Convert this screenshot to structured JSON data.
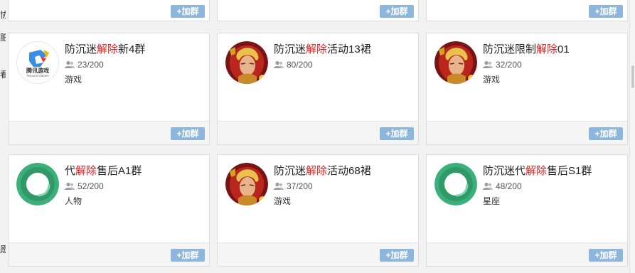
{
  "join_label": "+加群",
  "left_glimpse": [
    "协",
    "肥",
    "看",
    "愿"
  ],
  "groups": [
    {
      "pre": "防沉迷",
      "hl": "解除",
      "post": "新4群",
      "members": "23/200",
      "category": "游戏",
      "avatar": "tencent-games",
      "avatar_text": "腾讯游戏",
      "avatar_sub": "Tencent Games"
    },
    {
      "pre": "防沉迷",
      "hl": "解除",
      "post": "活动13裙",
      "members": "80/200",
      "category": "",
      "avatar": "hero"
    },
    {
      "pre": "防沉迷限制",
      "hl": "解除",
      "post": "01",
      "members": "32/200",
      "category": "游戏",
      "avatar": "hero"
    },
    {
      "pre": "代",
      "hl": "解除",
      "post": "售后A1群",
      "members": "52/200",
      "category": "人物",
      "avatar": "green-ring"
    },
    {
      "pre": "防沉迷",
      "hl": "解除",
      "post": "活动68裙",
      "members": "37/200",
      "category": "游戏",
      "avatar": "hero"
    },
    {
      "pre": "防沉迷代",
      "hl": "解除",
      "post": "售后S1群",
      "members": "48/200",
      "category": "星座",
      "avatar": "green-ring"
    }
  ]
}
